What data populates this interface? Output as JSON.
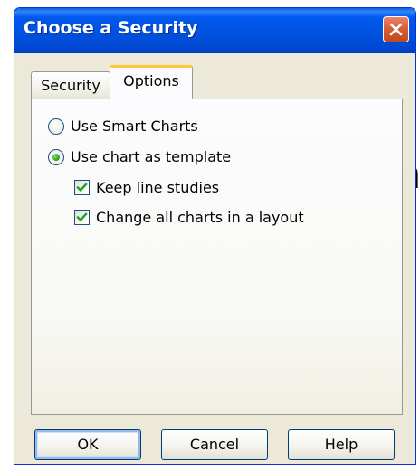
{
  "window": {
    "title": "Choose a Security",
    "close_icon": "close-icon"
  },
  "background": {
    "edge_letter": "n"
  },
  "tabs": [
    {
      "label": "Security",
      "selected": false
    },
    {
      "label": "Options",
      "selected": true
    }
  ],
  "options": {
    "use_smart_charts": {
      "label": "Use Smart Charts",
      "checked": false
    },
    "use_chart_as_template": {
      "label": "Use chart as template",
      "checked": true
    },
    "keep_line_studies": {
      "label": "Keep line studies",
      "checked": true
    },
    "change_all_charts": {
      "label": "Change all charts in a layout",
      "checked": true
    }
  },
  "buttons": {
    "ok": "OK",
    "cancel": "Cancel",
    "help": "Help"
  },
  "colors": {
    "titlebar": "#0054E3",
    "window_face": "#ECE9D8",
    "active_tab_accent": "#FFC83C",
    "close_button": "#D55B33",
    "check_mark": "#21A121"
  }
}
